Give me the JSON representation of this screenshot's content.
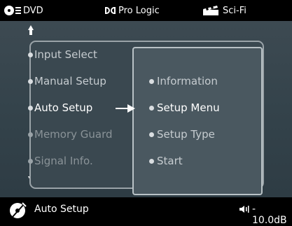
{
  "status_bar": {
    "source": "DVD",
    "surround_mode": "Pro Logic",
    "genre": "Sci-Fi"
  },
  "menu": {
    "items": [
      {
        "label": "Input Select",
        "state": "normal"
      },
      {
        "label": "Manual Setup",
        "state": "normal"
      },
      {
        "label": "Auto Setup",
        "state": "selected"
      },
      {
        "label": "Memory Guard",
        "state": "dim"
      },
      {
        "label": "Signal Info.",
        "state": "dim"
      }
    ],
    "submenu": [
      {
        "label": "Information",
        "state": "normal"
      },
      {
        "label": "Setup Menu",
        "state": "selected"
      },
      {
        "label": "Setup Type",
        "state": "normal"
      },
      {
        "label": "Start",
        "state": "normal"
      }
    ]
  },
  "bottom_bar": {
    "title": "Auto Setup",
    "volume": "- 10.0dB"
  },
  "colors": {
    "background": "#000000",
    "panel": "#3a4850",
    "selected_text": "#ffffff",
    "normal_text": "#c6ccd0",
    "dim_text": "#8a9398"
  }
}
